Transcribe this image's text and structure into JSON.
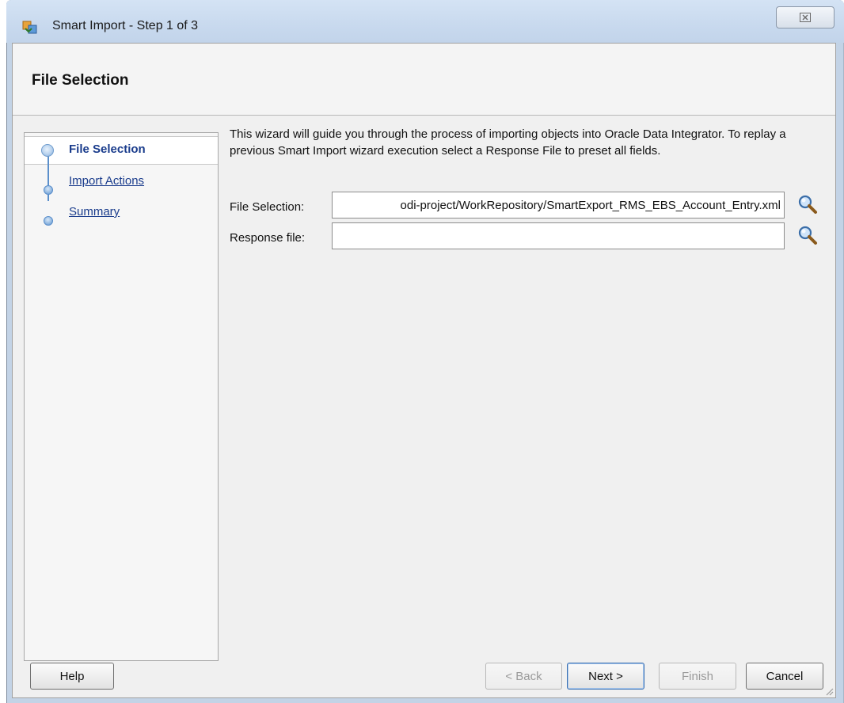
{
  "window": {
    "title": "Smart Import - Step 1 of 3",
    "close_glyph": "☒",
    "icon": "odi-smart-import-icon"
  },
  "header": {
    "title": "File Selection"
  },
  "nav": {
    "items": [
      {
        "label": "File Selection",
        "state": "active"
      },
      {
        "label": "Import Actions",
        "state": "link"
      },
      {
        "label": "Summary",
        "state": "link"
      }
    ]
  },
  "main": {
    "intro_text": "This wizard will guide you through the process of importing objects into Oracle Data Integrator. To replay a previous Smart Import wizard execution select a Response File to preset all fields.",
    "file_selection": {
      "label": "File Selection:",
      "value": "odi-project/WorkRepository/SmartExport_RMS_EBS_Account_Entry.xml"
    },
    "response_file": {
      "label": "Response file:",
      "value": ""
    }
  },
  "buttons": {
    "help": "Help",
    "back": "< Back",
    "next": "Next >",
    "finish": "Finish",
    "cancel": "Cancel"
  },
  "colors": {
    "link": "#1a3c8c",
    "nav_accent": "#5b8fcb",
    "titlebar": "#c8d9ee"
  }
}
